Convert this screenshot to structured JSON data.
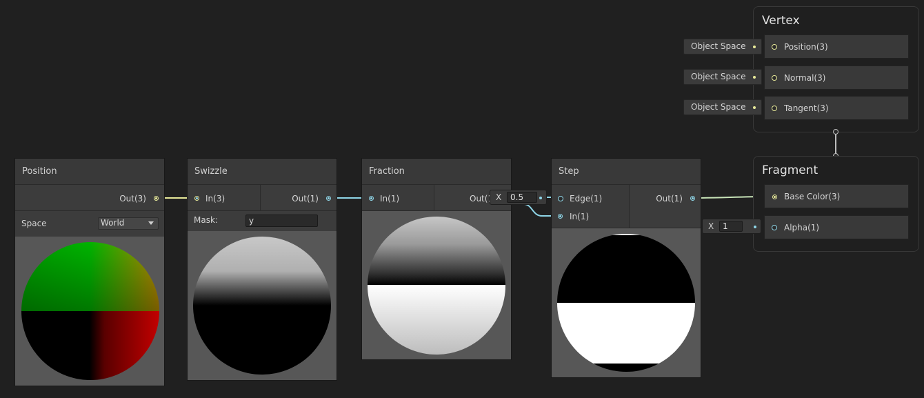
{
  "colors": {
    "background": "#202020",
    "wire_vector3": "#e8ea9a",
    "wire_vector1": "#8fd6e8"
  },
  "nodes": {
    "position": {
      "title": "Position",
      "out_label": "Out(3)",
      "space_label": "Space",
      "space_value": "World"
    },
    "swizzle": {
      "title": "Swizzle",
      "in_label": "In(3)",
      "out_label": "Out(1)",
      "mask_label": "Mask:",
      "mask_value": "y"
    },
    "fraction": {
      "title": "Fraction",
      "in_label": "In(1)",
      "out_label": "Out(1)"
    },
    "step": {
      "title": "Step",
      "edge_label": "Edge(1)",
      "in_label": "In(1)",
      "out_label": "Out(1)",
      "edge_default": {
        "axis": "X",
        "value": "0.5"
      }
    }
  },
  "master": {
    "vertex": {
      "title": "Vertex",
      "slots": [
        {
          "label": "Position(3)",
          "default": "Object Space"
        },
        {
          "label": "Normal(3)",
          "default": "Object Space"
        },
        {
          "label": "Tangent(3)",
          "default": "Object Space"
        }
      ]
    },
    "fragment": {
      "title": "Fragment",
      "slots": [
        {
          "label": "Base Color(3)"
        },
        {
          "label": "Alpha(1)",
          "default": {
            "axis": "X",
            "value": "1"
          }
        }
      ]
    }
  }
}
